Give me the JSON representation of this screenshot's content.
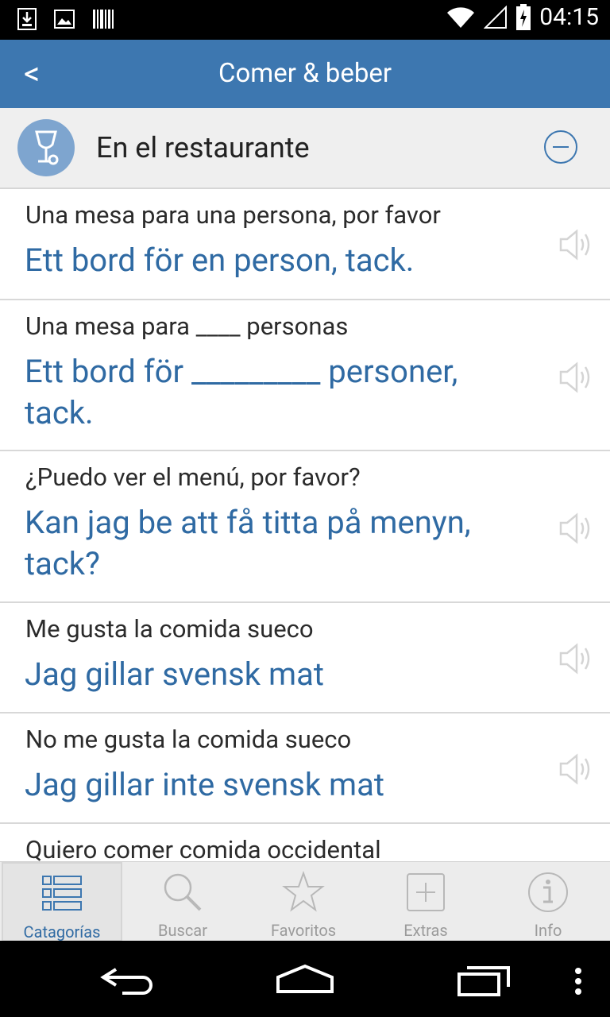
{
  "status_bar": {
    "time": "04:15"
  },
  "app_bar": {
    "back_label": "<",
    "title": "Comer & beber"
  },
  "category": {
    "title": "En el restaurante",
    "icon": "wine-glass-icon"
  },
  "phrases": [
    {
      "source": "Una mesa para una persona, por favor",
      "translation": "Ett bord för en person, tack."
    },
    {
      "source": "Una mesa para ____ personas",
      "translation": "Ett bord för _________ personer, tack."
    },
    {
      "source": "¿Puedo ver el menú, por favor?",
      "translation": "Kan jag be att få titta på menyn, tack?"
    },
    {
      "source": "Me gusta la comida sueco",
      "translation": "Jag gillar svensk mat"
    },
    {
      "source": "No me gusta la comida sueco",
      "translation": "Jag gillar inte svensk mat"
    },
    {
      "source": "Quiero comer comida occidental",
      "translation": ""
    }
  ],
  "tabs": [
    {
      "label": "Catagorías",
      "icon": "list-icon",
      "active": true
    },
    {
      "label": "Buscar",
      "icon": "search-icon",
      "active": false
    },
    {
      "label": "Favoritos",
      "icon": "star-icon",
      "active": false
    },
    {
      "label": "Extras",
      "icon": "plus-box-icon",
      "active": false
    },
    {
      "label": "Info",
      "icon": "info-icon",
      "active": false
    }
  ],
  "colors": {
    "accent": "#3d77b0",
    "translation_text": "#2f6aa3"
  }
}
